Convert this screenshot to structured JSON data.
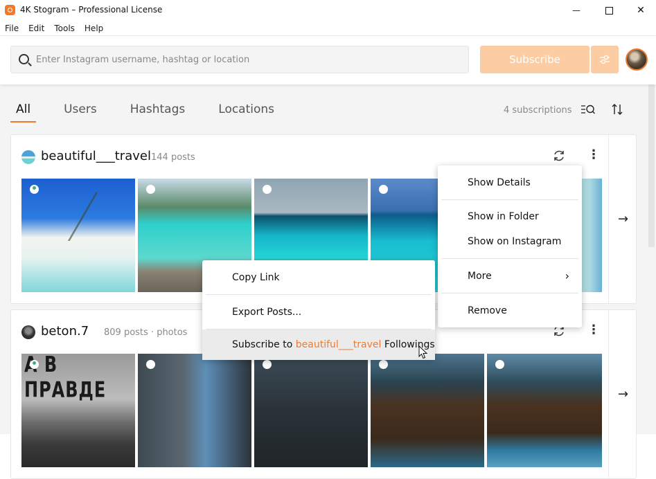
{
  "window": {
    "title": "4K Stogram – Professional License",
    "controls": {
      "minimize": "—",
      "maximize": "☐",
      "close": "✕"
    }
  },
  "menubar": [
    "File",
    "Edit",
    "Tools",
    "Help"
  ],
  "header": {
    "search_placeholder": "Enter Instagram username, hashtag or location",
    "search_value": "",
    "subscribe_label": "Subscribe",
    "colors": {
      "accent": "#f07a2c",
      "accent_light": "#fccca3"
    }
  },
  "toolbar": {
    "tabs": [
      {
        "label": "All",
        "active": true
      },
      {
        "label": "Users",
        "active": false
      },
      {
        "label": "Hashtags",
        "active": false
      },
      {
        "label": "Locations",
        "active": false
      }
    ],
    "subscriptions_count": "4 subscriptions",
    "icons": {
      "list_search": "≡Q",
      "sort": "⇅",
      "arrow_right": "→",
      "refresh": "↻",
      "more": "⋮"
    }
  },
  "subscriptions": [
    {
      "name": "beautiful___travel",
      "meta": "144 posts",
      "thumbs": [
        "beach-palm",
        "bora-bora-dock",
        "maldives-villas",
        "ocean-palms",
        "lagoon-teal"
      ]
    },
    {
      "name": "beton.7",
      "meta": "809 posts · photos",
      "thumbs": [
        "brick-wall-praвде",
        "old-balcony-building",
        "columns-building",
        "lake-forest",
        "lake-forest-2"
      ]
    }
  ],
  "context_menu_main": {
    "items": [
      "Show Details",
      "Show in Folder",
      "Show on Instagram",
      "More",
      "Remove"
    ]
  },
  "context_menu_more": {
    "items": [
      "Copy Link",
      "Export Posts..."
    ],
    "subscribe_prefix": "Subscribe to",
    "subscribe_user": "beautiful___travel",
    "subscribe_suffix": "Followings"
  }
}
